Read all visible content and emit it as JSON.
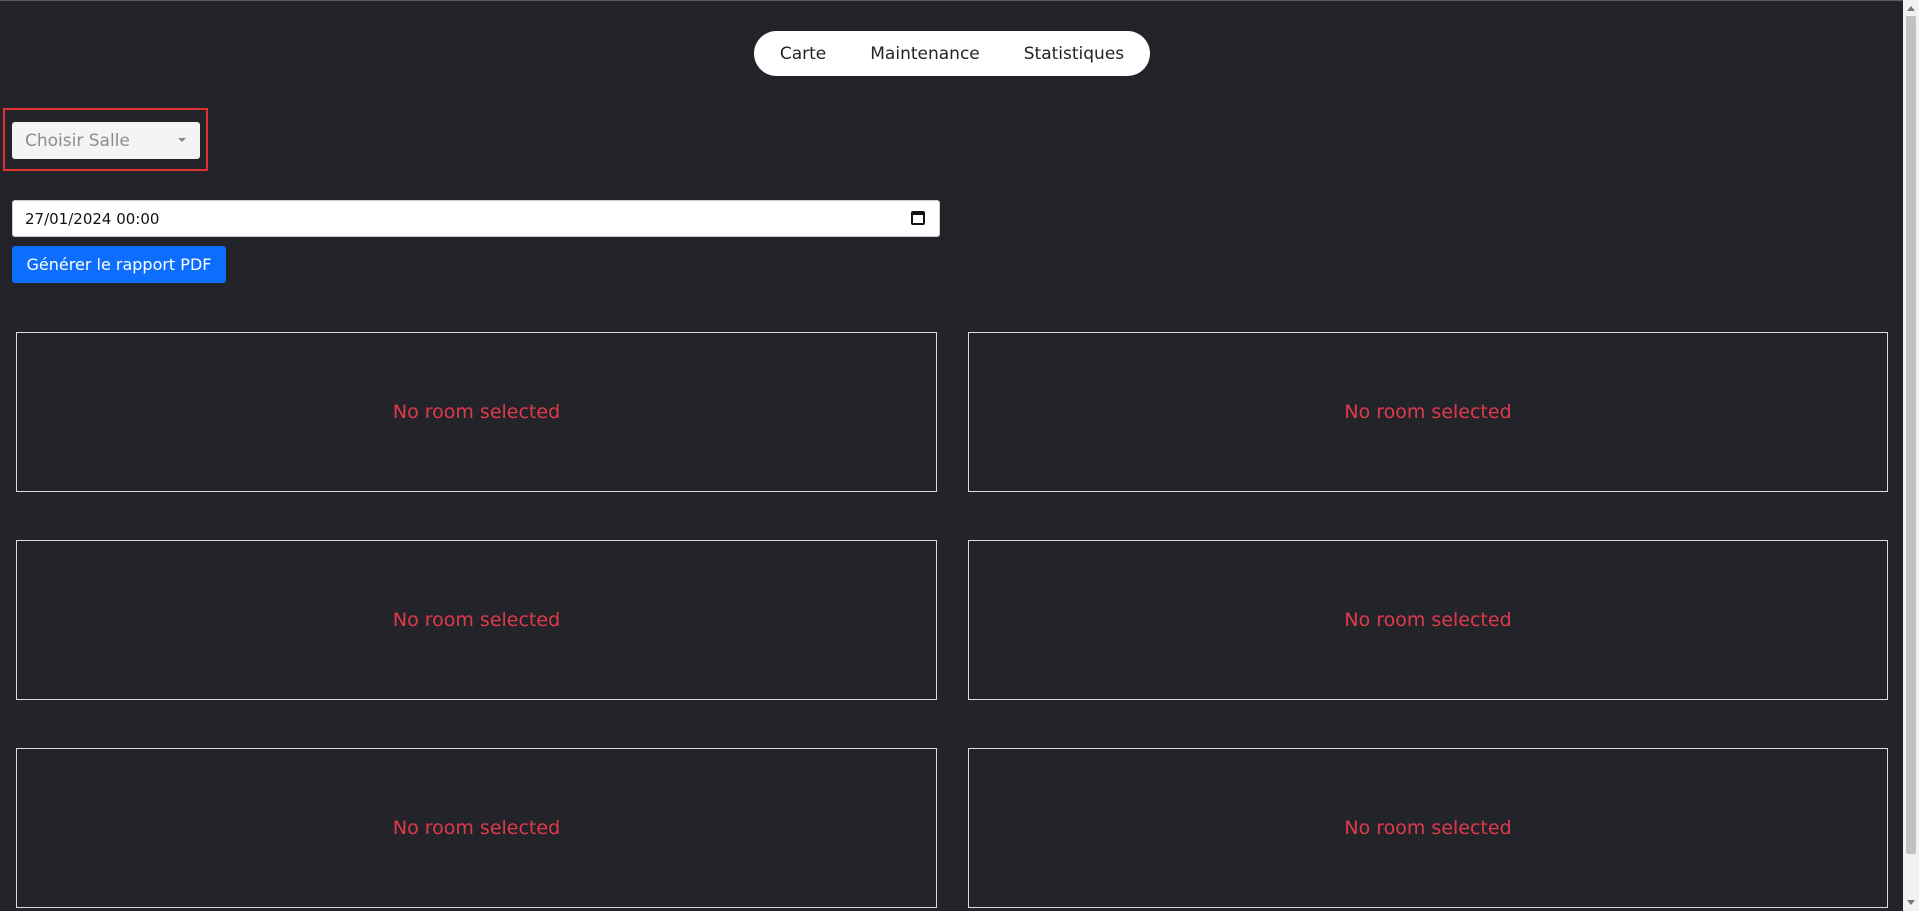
{
  "nav": {
    "items": [
      "Carte",
      "Maintenance",
      "Statistiques"
    ]
  },
  "room_select": {
    "placeholder": "Choisir Salle"
  },
  "date_input": {
    "value": "27/01/2024 00:00"
  },
  "pdf_button": {
    "label": "Générer le rapport PDF"
  },
  "panels": [
    {
      "message": "No room selected"
    },
    {
      "message": "No room selected"
    },
    {
      "message": "No room selected"
    },
    {
      "message": "No room selected"
    },
    {
      "message": "No room selected"
    },
    {
      "message": "No room selected"
    }
  ],
  "colors": {
    "background": "#23242a",
    "accent": "#0d6efd",
    "error": "#e0394a",
    "highlight": "#e03030"
  }
}
